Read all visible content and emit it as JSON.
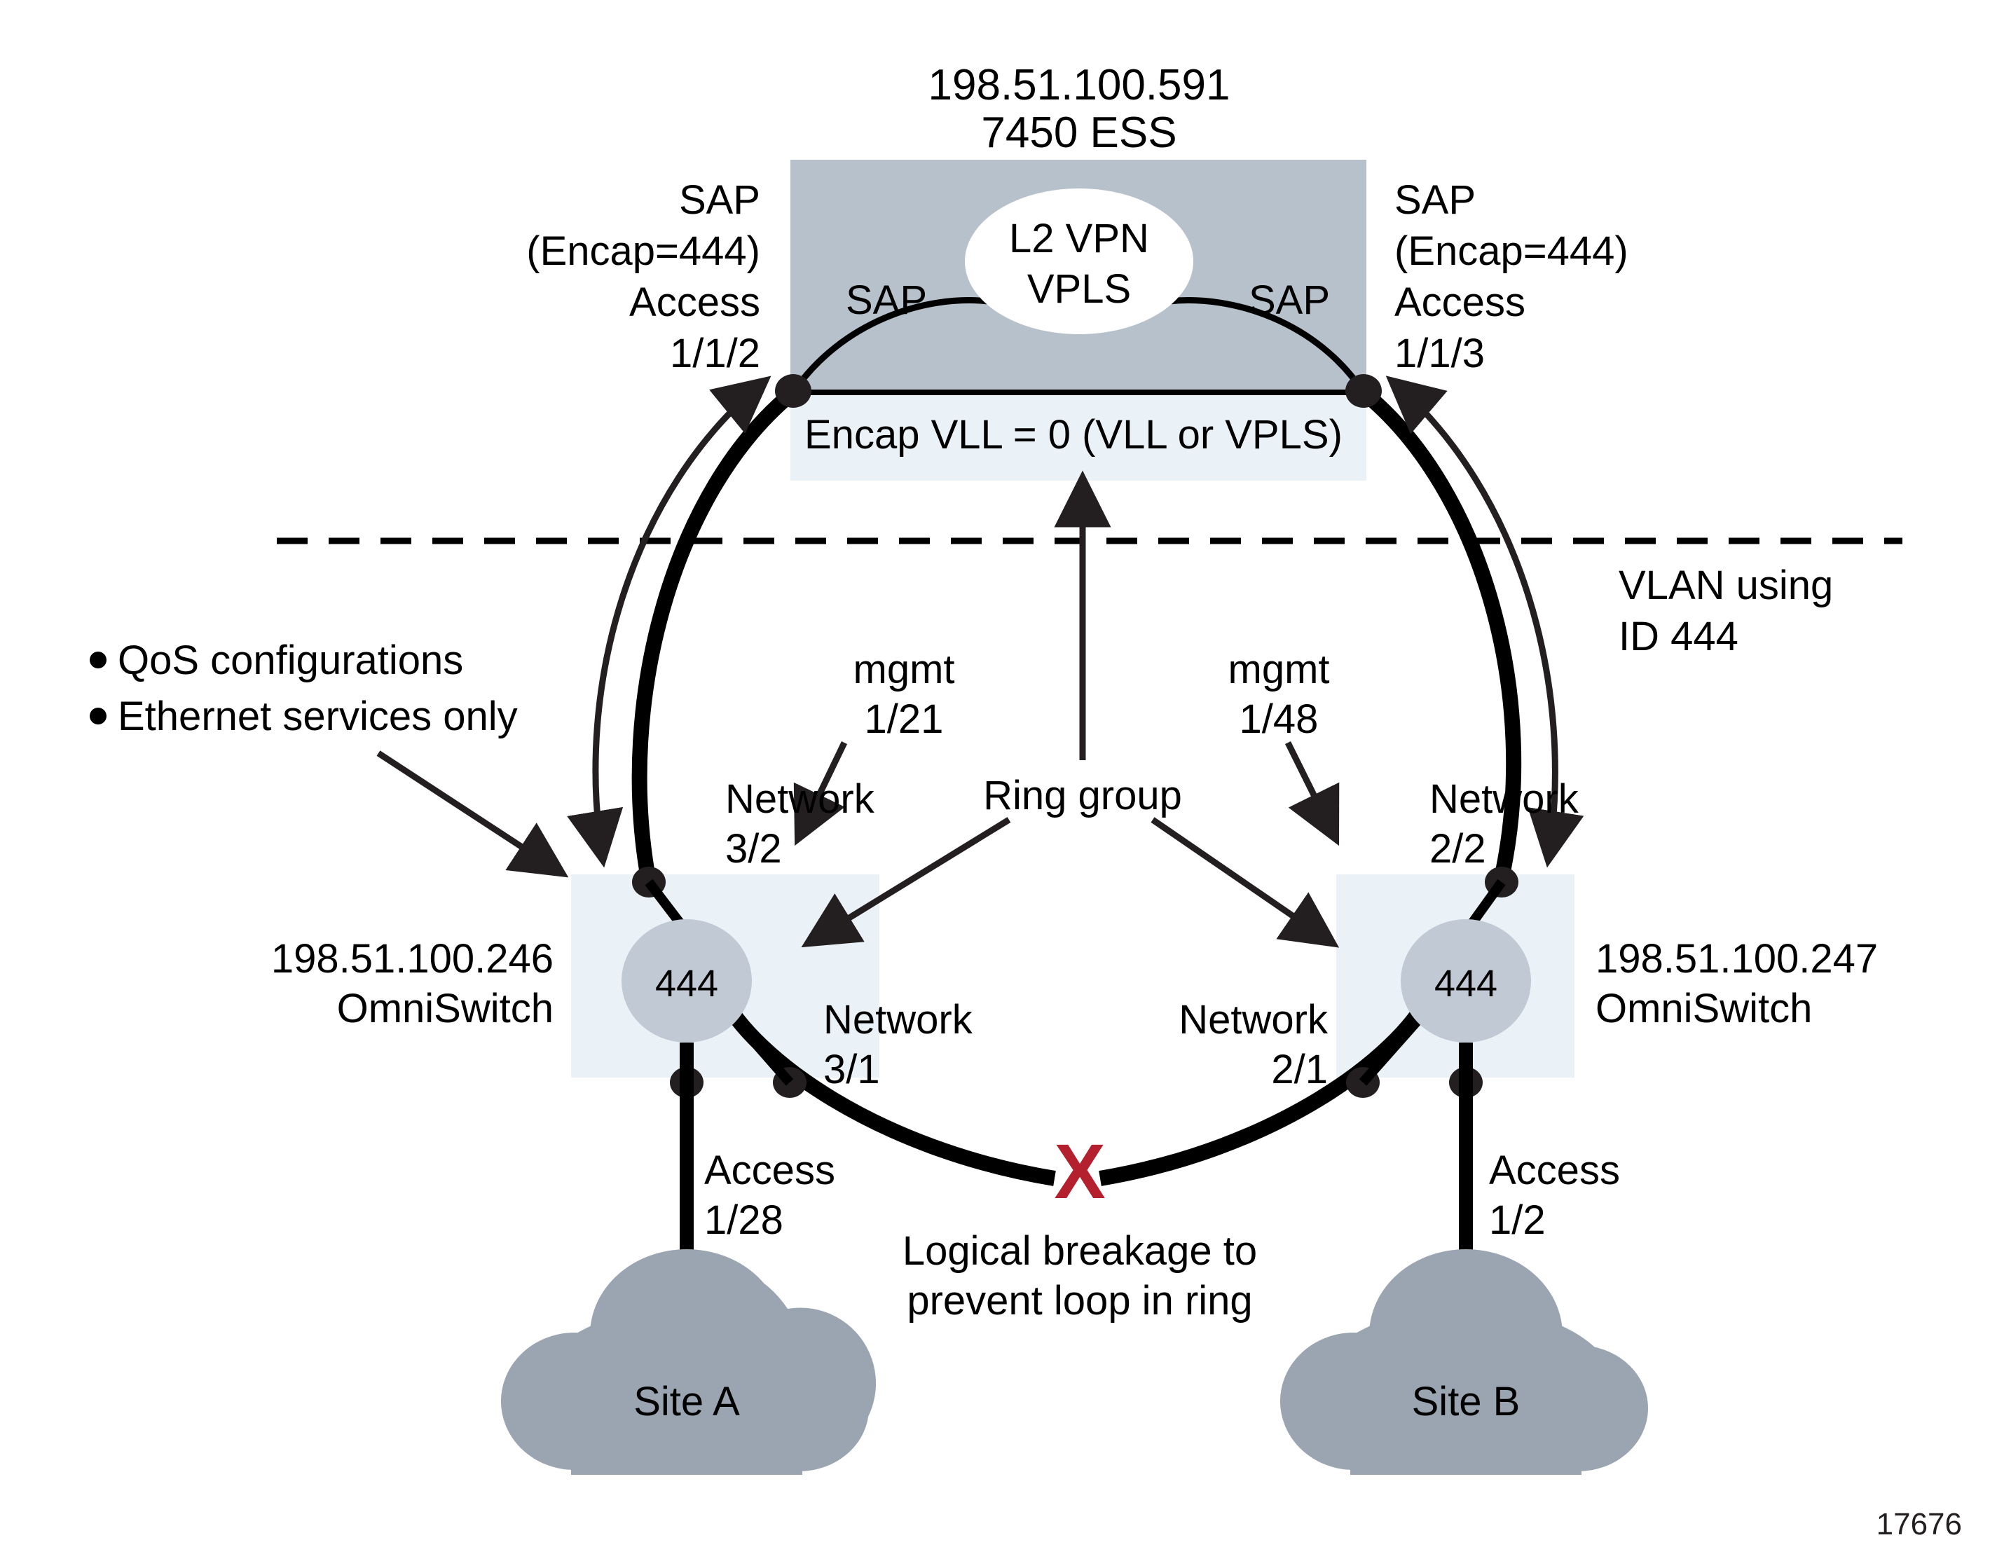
{
  "figure": {
    "id": "17676",
    "colors": {
      "ess_box": "#b7c1cc",
      "encap_strip": "#eaf1f7",
      "switch_box": "#eaf1f7",
      "vlan_circle": "#c0c9d4",
      "cloud": "#9aa5b1",
      "break_x": "#b5202e",
      "line": "#000000"
    }
  },
  "ess": {
    "ip": "198.51.100.591",
    "model": "7450 ESS",
    "service_line1": "L2 VPN",
    "service_line2": "VPLS",
    "sap_left_inner": "SAP",
    "sap_right_inner": "SAP",
    "encap_strip": "Encap VLL = 0 (VLL or VPLS)"
  },
  "sap_left": {
    "line1": "SAP",
    "line2": "(Encap=444)",
    "line3": "Access",
    "line4": "1/1/2"
  },
  "sap_right": {
    "line1": "SAP",
    "line2": "(Encap=444)",
    "line3": "Access",
    "line4": "1/1/3"
  },
  "vlan_note": {
    "line1": "VLAN using",
    "line2": "ID 444"
  },
  "bullets": {
    "item1": "QoS configurations",
    "item2": "Ethernet services only"
  },
  "mgmt_left": {
    "line1": "mgmt",
    "line2": "1/21"
  },
  "mgmt_right": {
    "line1": "mgmt",
    "line2": "1/48"
  },
  "ring_group": {
    "label": "Ring group"
  },
  "switch_left": {
    "ip": "198.51.100.246",
    "model": "OmniSwitch",
    "vlan_id": "444",
    "network_upper_line1": "Network",
    "network_upper_line2": "3/2",
    "network_lower_line1": "Network",
    "network_lower_line2": "3/1",
    "access_line1": "Access",
    "access_line2": "1/28"
  },
  "switch_right": {
    "ip": "198.51.100.247",
    "model": "OmniSwitch",
    "vlan_id": "444",
    "network_upper_line1": "Network",
    "network_upper_line2": "2/2",
    "network_lower_line1": "Network",
    "network_lower_line2": "2/1",
    "access_line1": "Access",
    "access_line2": "1/2"
  },
  "site_a": {
    "label": "Site A"
  },
  "site_b": {
    "label": "Site B"
  },
  "breakage": {
    "marker": "X",
    "caption_line1": "Logical breakage to",
    "caption_line2": "prevent loop in ring"
  }
}
